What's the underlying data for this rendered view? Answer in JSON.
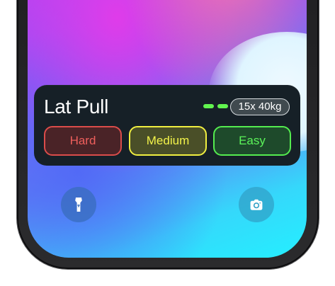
{
  "widget": {
    "exercise": "Lat Pull",
    "set_info": "15x 40kg",
    "progress_indicator": {
      "completed_sets": 2,
      "color": "#61f44f"
    },
    "difficulty_options": [
      {
        "label": "Hard",
        "color": "#ef5f5c"
      },
      {
        "label": "Medium",
        "color": "#f3f34a"
      },
      {
        "label": "Easy",
        "color": "#5cf45a"
      }
    ]
  },
  "lock_screen": {
    "left_action_icon": "flashlight-icon",
    "right_action_icon": "camera-icon"
  },
  "theme": {
    "widget_background": "#162027",
    "text_primary": "#ffffff"
  }
}
